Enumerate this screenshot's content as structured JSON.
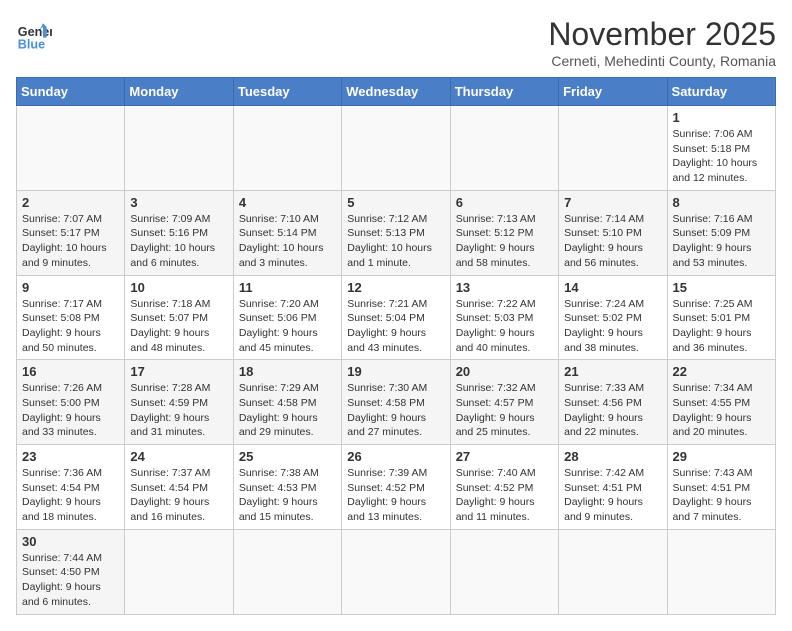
{
  "logo": {
    "text_general": "General",
    "text_blue": "Blue"
  },
  "title": "November 2025",
  "subtitle": "Cerneti, Mehedinti County, Romania",
  "weekdays": [
    "Sunday",
    "Monday",
    "Tuesday",
    "Wednesday",
    "Thursday",
    "Friday",
    "Saturday"
  ],
  "weeks": [
    [
      {
        "day": "",
        "info": ""
      },
      {
        "day": "",
        "info": ""
      },
      {
        "day": "",
        "info": ""
      },
      {
        "day": "",
        "info": ""
      },
      {
        "day": "",
        "info": ""
      },
      {
        "day": "",
        "info": ""
      },
      {
        "day": "1",
        "info": "Sunrise: 7:06 AM\nSunset: 5:18 PM\nDaylight: 10 hours and 12 minutes."
      }
    ],
    [
      {
        "day": "2",
        "info": "Sunrise: 7:07 AM\nSunset: 5:17 PM\nDaylight: 10 hours and 9 minutes."
      },
      {
        "day": "3",
        "info": "Sunrise: 7:09 AM\nSunset: 5:16 PM\nDaylight: 10 hours and 6 minutes."
      },
      {
        "day": "4",
        "info": "Sunrise: 7:10 AM\nSunset: 5:14 PM\nDaylight: 10 hours and 3 minutes."
      },
      {
        "day": "5",
        "info": "Sunrise: 7:12 AM\nSunset: 5:13 PM\nDaylight: 10 hours and 1 minute."
      },
      {
        "day": "6",
        "info": "Sunrise: 7:13 AM\nSunset: 5:12 PM\nDaylight: 9 hours and 58 minutes."
      },
      {
        "day": "7",
        "info": "Sunrise: 7:14 AM\nSunset: 5:10 PM\nDaylight: 9 hours and 56 minutes."
      },
      {
        "day": "8",
        "info": "Sunrise: 7:16 AM\nSunset: 5:09 PM\nDaylight: 9 hours and 53 minutes."
      }
    ],
    [
      {
        "day": "9",
        "info": "Sunrise: 7:17 AM\nSunset: 5:08 PM\nDaylight: 9 hours and 50 minutes."
      },
      {
        "day": "10",
        "info": "Sunrise: 7:18 AM\nSunset: 5:07 PM\nDaylight: 9 hours and 48 minutes."
      },
      {
        "day": "11",
        "info": "Sunrise: 7:20 AM\nSunset: 5:06 PM\nDaylight: 9 hours and 45 minutes."
      },
      {
        "day": "12",
        "info": "Sunrise: 7:21 AM\nSunset: 5:04 PM\nDaylight: 9 hours and 43 minutes."
      },
      {
        "day": "13",
        "info": "Sunrise: 7:22 AM\nSunset: 5:03 PM\nDaylight: 9 hours and 40 minutes."
      },
      {
        "day": "14",
        "info": "Sunrise: 7:24 AM\nSunset: 5:02 PM\nDaylight: 9 hours and 38 minutes."
      },
      {
        "day": "15",
        "info": "Sunrise: 7:25 AM\nSunset: 5:01 PM\nDaylight: 9 hours and 36 minutes."
      }
    ],
    [
      {
        "day": "16",
        "info": "Sunrise: 7:26 AM\nSunset: 5:00 PM\nDaylight: 9 hours and 33 minutes."
      },
      {
        "day": "17",
        "info": "Sunrise: 7:28 AM\nSunset: 4:59 PM\nDaylight: 9 hours and 31 minutes."
      },
      {
        "day": "18",
        "info": "Sunrise: 7:29 AM\nSunset: 4:58 PM\nDaylight: 9 hours and 29 minutes."
      },
      {
        "day": "19",
        "info": "Sunrise: 7:30 AM\nSunset: 4:58 PM\nDaylight: 9 hours and 27 minutes."
      },
      {
        "day": "20",
        "info": "Sunrise: 7:32 AM\nSunset: 4:57 PM\nDaylight: 9 hours and 25 minutes."
      },
      {
        "day": "21",
        "info": "Sunrise: 7:33 AM\nSunset: 4:56 PM\nDaylight: 9 hours and 22 minutes."
      },
      {
        "day": "22",
        "info": "Sunrise: 7:34 AM\nSunset: 4:55 PM\nDaylight: 9 hours and 20 minutes."
      }
    ],
    [
      {
        "day": "23",
        "info": "Sunrise: 7:36 AM\nSunset: 4:54 PM\nDaylight: 9 hours and 18 minutes."
      },
      {
        "day": "24",
        "info": "Sunrise: 7:37 AM\nSunset: 4:54 PM\nDaylight: 9 hours and 16 minutes."
      },
      {
        "day": "25",
        "info": "Sunrise: 7:38 AM\nSunset: 4:53 PM\nDaylight: 9 hours and 15 minutes."
      },
      {
        "day": "26",
        "info": "Sunrise: 7:39 AM\nSunset: 4:52 PM\nDaylight: 9 hours and 13 minutes."
      },
      {
        "day": "27",
        "info": "Sunrise: 7:40 AM\nSunset: 4:52 PM\nDaylight: 9 hours and 11 minutes."
      },
      {
        "day": "28",
        "info": "Sunrise: 7:42 AM\nSunset: 4:51 PM\nDaylight: 9 hours and 9 minutes."
      },
      {
        "day": "29",
        "info": "Sunrise: 7:43 AM\nSunset: 4:51 PM\nDaylight: 9 hours and 7 minutes."
      }
    ],
    [
      {
        "day": "30",
        "info": "Sunrise: 7:44 AM\nSunset: 4:50 PM\nDaylight: 9 hours and 6 minutes."
      },
      {
        "day": "",
        "info": ""
      },
      {
        "day": "",
        "info": ""
      },
      {
        "day": "",
        "info": ""
      },
      {
        "day": "",
        "info": ""
      },
      {
        "day": "",
        "info": ""
      },
      {
        "day": "",
        "info": ""
      }
    ]
  ]
}
